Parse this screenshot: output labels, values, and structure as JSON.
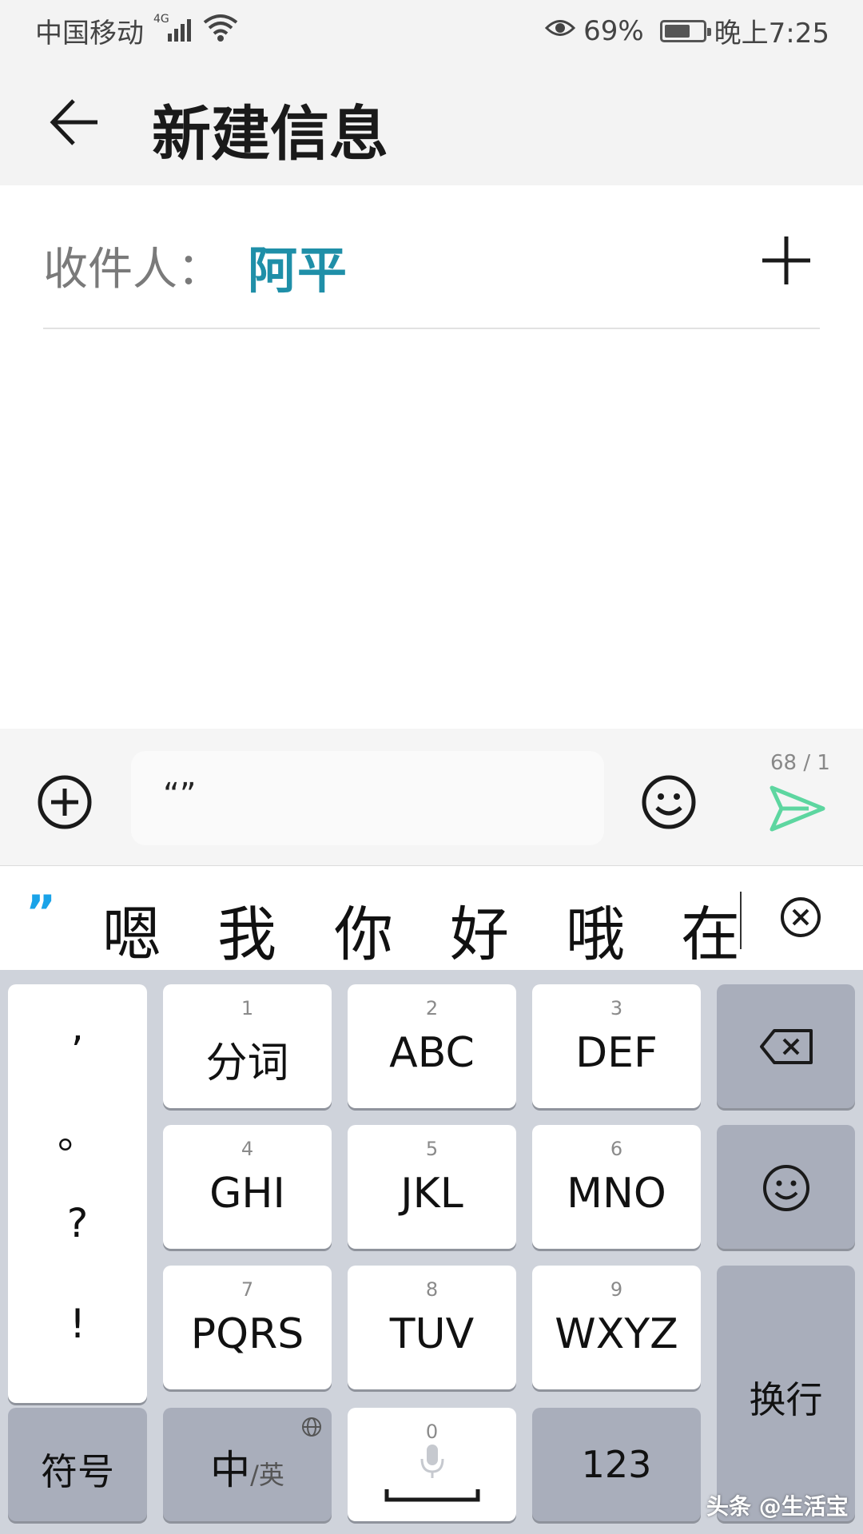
{
  "status_bar": {
    "carrier": "中国移动",
    "network": "4G",
    "battery": "69%",
    "battery_level": 0.69,
    "time": "晚上7:25"
  },
  "header": {
    "title": "新建信息"
  },
  "recipient": {
    "label": "收件人：",
    "name": "阿平"
  },
  "composer": {
    "message_text": "“”",
    "counter": "68 / 1"
  },
  "candidates": {
    "quote": "”",
    "items": [
      "嗯",
      "我",
      "你",
      "好",
      "哦",
      "在"
    ]
  },
  "keyboard": {
    "punctuation": [
      ",",
      "。",
      "?",
      "!"
    ],
    "keys": [
      {
        "num": "1",
        "label": "分词"
      },
      {
        "num": "2",
        "label": "ABC"
      },
      {
        "num": "3",
        "label": "DEF"
      },
      {
        "num": "4",
        "label": "GHI"
      },
      {
        "num": "5",
        "label": "JKL"
      },
      {
        "num": "6",
        "label": "MNO"
      },
      {
        "num": "7",
        "label": "PQRS"
      },
      {
        "num": "8",
        "label": "TUV"
      },
      {
        "num": "9",
        "label": "WXYZ"
      }
    ],
    "symbols": "符号",
    "lang_main": "中",
    "lang_alt": "/英",
    "space_num": "0",
    "numbers": "123",
    "enter": "换行"
  },
  "watermark": "头条 @生活宝",
  "colors": {
    "accent": "#1f8fa8",
    "send": "#5dd6a0",
    "candidate_quote": "#1aa3e8",
    "keyboard_bg": "#cfd3db",
    "dark_key": "#a9aebb"
  }
}
